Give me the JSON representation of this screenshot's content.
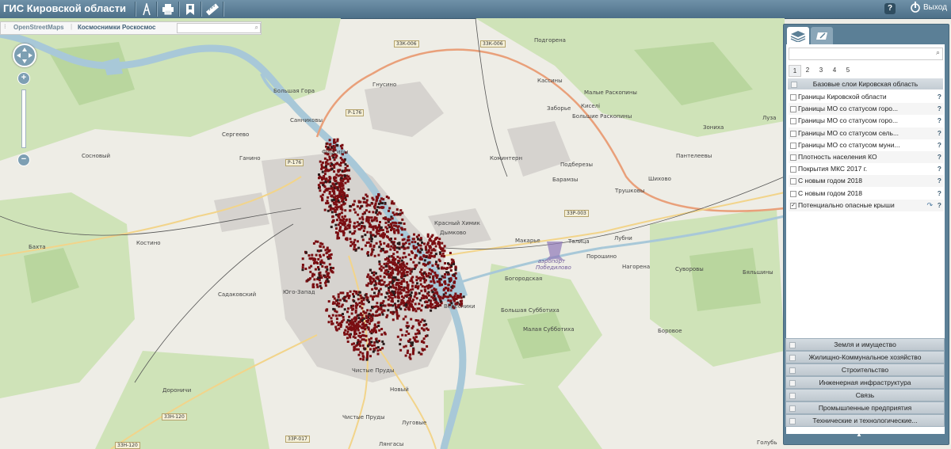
{
  "app": {
    "title": "ГИС Кировской области"
  },
  "toolbar": {
    "tools": [
      {
        "icon": "measure-icon"
      },
      {
        "icon": "print-icon"
      },
      {
        "icon": "bookmark-icon"
      },
      {
        "icon": "ruler-icon"
      }
    ],
    "help_label": "?",
    "logout_label": "Выход"
  },
  "basemaps": {
    "tabs": [
      {
        "label": "OpenStreetMaps"
      },
      {
        "label": "Космоснимки Роскосмос"
      }
    ],
    "search_placeholder": ""
  },
  "zoom": {
    "in_label": "+",
    "out_label": "−"
  },
  "map_labels": [
    {
      "text": "Подгорена"
    },
    {
      "text": "Гнусино"
    },
    {
      "text": "Кассины"
    },
    {
      "text": "Малые Раскопины"
    },
    {
      "text": "Заборье"
    },
    {
      "text": "Киселі"
    },
    {
      "text": "Большие Раскопины"
    },
    {
      "text": "Большая Гора"
    },
    {
      "text": "Санниковы"
    },
    {
      "text": "Сергеево"
    },
    {
      "text": "Ганино"
    },
    {
      "text": "Сосновый"
    },
    {
      "text": "Коминтерн"
    },
    {
      "text": "Подберезы"
    },
    {
      "text": "Барамзы"
    },
    {
      "text": "Трушковы"
    },
    {
      "text": "Шихово"
    },
    {
      "text": "Пантелеевы"
    },
    {
      "text": "Зониха"
    },
    {
      "text": "Луза"
    },
    {
      "text": "Красный Химик"
    },
    {
      "text": "Дымково"
    },
    {
      "text": "Макарье"
    },
    {
      "text": "Талица"
    },
    {
      "text": "Лубни"
    },
    {
      "text": "Порошино"
    },
    {
      "text": "Нагорена"
    },
    {
      "text": "Бахта"
    },
    {
      "text": "Костино"
    },
    {
      "text": "Садаковский"
    },
    {
      "text": "Юго-Запад"
    },
    {
      "text": "Богородская"
    },
    {
      "text": "аэропорт Победилово"
    },
    {
      "text": "Суворовы"
    },
    {
      "text": "Бяльшины"
    },
    {
      "text": "Вересники"
    },
    {
      "text": "Большая Субботиха"
    },
    {
      "text": "Малая Субботиха"
    },
    {
      "text": "Боровое"
    },
    {
      "text": "Чистые Пруды"
    },
    {
      "text": "Новый"
    },
    {
      "text": "Дороничи"
    },
    {
      "text": "Чистые Пруды"
    },
    {
      "text": "Луговые"
    },
    {
      "text": "Лянгасы"
    },
    {
      "text": "Фирсиры"
    },
    {
      "text": "Голубь"
    }
  ],
  "road_shields": [
    {
      "text": "33К-006"
    },
    {
      "text": "33К-006"
    },
    {
      "text": "Р-176"
    },
    {
      "text": "Р-176"
    },
    {
      "text": "33Р-003"
    },
    {
      "text": "33Н-120"
    },
    {
      "text": "33Н-120"
    },
    {
      "text": "33Р-017"
    }
  ],
  "layers_panel": {
    "tabs": [
      {
        "icon": "layers-icon"
      },
      {
        "icon": "edit-icon"
      }
    ],
    "search_placeholder": "",
    "pages": [
      "1",
      "2",
      "3",
      "4",
      "5"
    ],
    "active_page": "1",
    "group_title": "Базовые слои Кировская область",
    "layers": [
      {
        "name": "Границы Кировской области",
        "checked": false,
        "help": "?"
      },
      {
        "name": "Границы МО со статусом горо...",
        "checked": false,
        "help": "?"
      },
      {
        "name": "Границы МО со статусом горо...",
        "checked": false,
        "help": "?"
      },
      {
        "name": "Границы МО со статусом сель...",
        "checked": false,
        "help": "?"
      },
      {
        "name": "Границы МО со статусом муни...",
        "checked": false,
        "help": "?"
      },
      {
        "name": "Плотность населения КО",
        "checked": false,
        "help": "?"
      },
      {
        "name": "Покрытия МКС 2017 г.",
        "checked": false,
        "help": "?"
      },
      {
        "name": "С новым годом 2018",
        "checked": false,
        "help": "?"
      },
      {
        "name": "С новым годом 2018",
        "checked": false,
        "help": "?"
      },
      {
        "name": "Потенциально опасные крыши",
        "checked": true,
        "help": "?"
      }
    ],
    "groups": [
      "Земля и имущество",
      "Жилищно-Коммунальное хозяйство",
      "Строительство",
      "Инженерная инфраструктура",
      "Связь",
      "Промышленные предприятия",
      "Технические и технологические..."
    ],
    "collapse_label": "▲"
  },
  "colors": {
    "header": "#5b7f96",
    "hazard_marker": "#7a0e12",
    "river": "#a8c8d8",
    "forest": "#cfe3b8"
  }
}
